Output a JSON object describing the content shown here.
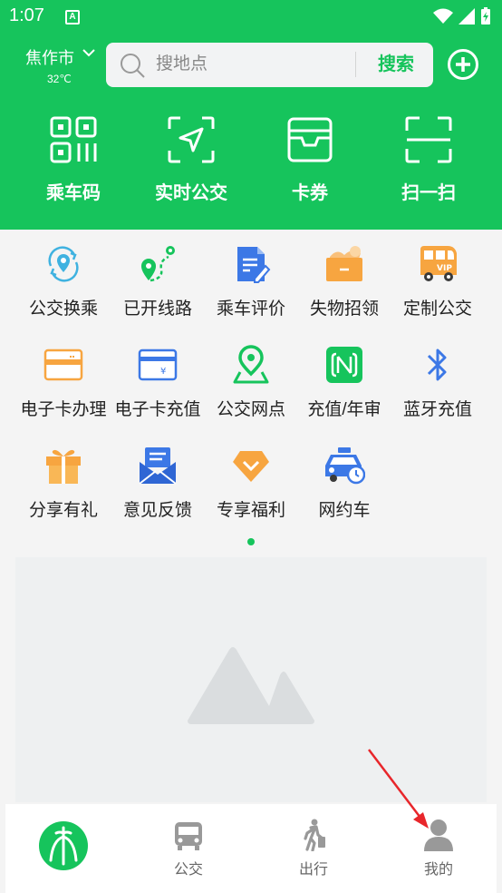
{
  "status_bar": {
    "time": "1:07",
    "notification_badge": "A"
  },
  "header": {
    "city": "焦作市",
    "temperature": "32℃",
    "search": {
      "placeholder": "搜地点",
      "button_label": "搜索"
    },
    "colors": {
      "brand": "#16c45c"
    }
  },
  "top_actions": [
    {
      "label": "乘车码",
      "icon": "qr-code-icon"
    },
    {
      "label": "实时公交",
      "icon": "realtime-navigation-icon"
    },
    {
      "label": "卡券",
      "icon": "card-wallet-icon"
    },
    {
      "label": "扫一扫",
      "icon": "scan-icon"
    }
  ],
  "grid": [
    {
      "label": "公交换乘",
      "icon": "transfer-location-icon"
    },
    {
      "label": "已开线路",
      "icon": "route-icon"
    },
    {
      "label": "乘车评价",
      "icon": "review-doc-icon"
    },
    {
      "label": "失物招领",
      "icon": "lost-found-icon"
    },
    {
      "label": "定制公交",
      "icon": "vip-bus-icon"
    },
    {
      "label": "电子卡办理",
      "icon": "ecard-icon"
    },
    {
      "label": "电子卡充值",
      "icon": "ecard-recharge-icon"
    },
    {
      "label": "公交网点",
      "icon": "service-point-icon"
    },
    {
      "label": "充值/年审",
      "icon": "nfc-icon"
    },
    {
      "label": "蓝牙充值",
      "icon": "bluetooth-icon"
    },
    {
      "label": "分享有礼",
      "icon": "gift-icon"
    },
    {
      "label": "意见反馈",
      "icon": "feedback-mail-icon"
    },
    {
      "label": "专享福利",
      "icon": "diamond-icon"
    },
    {
      "label": "网约车",
      "icon": "taxi-icon"
    }
  ],
  "bottom_nav": [
    {
      "label": "",
      "icon": "home-logo-icon"
    },
    {
      "label": "公交",
      "icon": "bus-icon"
    },
    {
      "label": "出行",
      "icon": "walking-icon"
    },
    {
      "label": "我的",
      "icon": "profile-icon"
    }
  ]
}
